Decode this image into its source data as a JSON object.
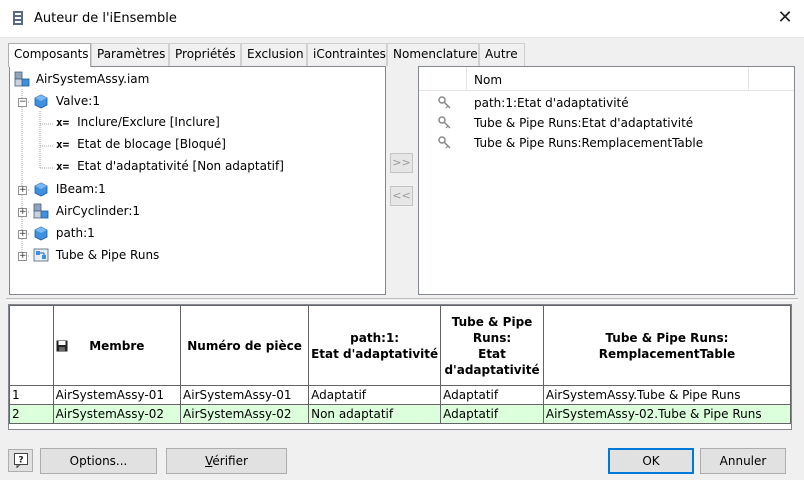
{
  "window": {
    "title": "Auteur de l'iEnsemble",
    "close_glyph": "✕"
  },
  "tabs": [
    {
      "label": "Composants",
      "active": true
    },
    {
      "label": "Paramètres",
      "active": false
    },
    {
      "label": "Propriétés",
      "active": false
    },
    {
      "label": "Exclusion",
      "active": false
    },
    {
      "label": "iContraintes",
      "active": false
    },
    {
      "label": "Nomenclature",
      "active": false
    },
    {
      "label": "Autre",
      "active": false
    }
  ],
  "tree": {
    "root": "AirSystemAssy.iam",
    "valve": "Valve:1",
    "valve_children": [
      {
        "prefix": "x=",
        "label": "Inclure/Exclure [Inclure]"
      },
      {
        "prefix": "x=",
        "label": "Etat de blocage [Bloqué]"
      },
      {
        "prefix": "x=",
        "label": "Etat d'adaptativité [Non adaptatif]"
      }
    ],
    "ibeam": "IBeam:1",
    "aircylinder": "AirCyclinder:1",
    "path": "path:1",
    "tube": "Tube & Pipe Runs"
  },
  "transfer": {
    "add": ">>",
    "remove": "<<"
  },
  "selected_list": {
    "header": "Nom",
    "items": [
      "path:1:Etat d'adaptativité",
      "Tube & Pipe Runs:Etat d'adaptativité",
      "Tube & Pipe Runs:RemplacementTable"
    ]
  },
  "grid": {
    "headers": {
      "member": "Membre",
      "part_number": "Numéro de pièce",
      "path_line1": "path:1:",
      "path_line2": "Etat d'adaptativité",
      "tube_line1": "Tube & Pipe",
      "tube_line2": "Runs:",
      "tube_line3": "Etat",
      "tube_line4": "d'adaptativité",
      "table_line1": "Tube & Pipe Runs:",
      "table_line2": "RemplacementTable"
    },
    "rows": [
      {
        "num": "1",
        "member": "AirSystemAssy-01",
        "part": "AirSystemAssy-01",
        "path": "Adaptatif",
        "tube": "Adaptatif",
        "table": "AirSystemAssy.Tube & Pipe Runs"
      },
      {
        "num": "2",
        "member": "AirSystemAssy-02",
        "part": "AirSystemAssy-02",
        "path": "Non adaptatif",
        "tube": "Adaptatif",
        "table": "AirSystemAssy-02.Tube & Pipe Runs"
      }
    ]
  },
  "buttons": {
    "help": "?",
    "options": "Options...",
    "verify_underlined": "V",
    "verify_rest": "érifier",
    "ok": "OK",
    "cancel": "Annuler"
  },
  "colors": {
    "selected_row": "#dcffdc",
    "cube_blue": "#3d8fe0",
    "default_button_border": "#0078d7"
  },
  "icons": {
    "title": "iassembly-author-icon",
    "assembly": "assembly-icon",
    "part": "part-cube-icon",
    "key": "key-icon",
    "save": "save-icon"
  }
}
